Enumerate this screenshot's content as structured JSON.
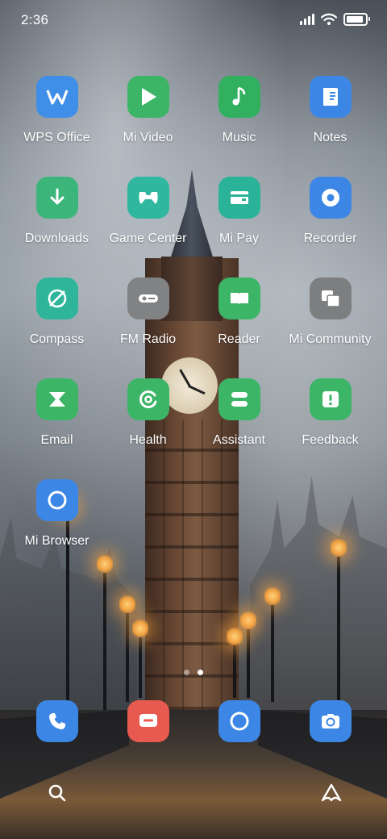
{
  "status_bar": {
    "time": "2:36",
    "icons": [
      "signal-icon",
      "wifi-icon",
      "battery-icon"
    ]
  },
  "apps": [
    {
      "label": "WPS Office",
      "icon": "wps-office-icon",
      "color": "#3f8ee8"
    },
    {
      "label": "Mi Video",
      "icon": "play-icon",
      "color": "#3cb567"
    },
    {
      "label": "Music",
      "icon": "music-note-icon",
      "color": "#31b060"
    },
    {
      "label": "Notes",
      "icon": "notes-icon",
      "color": "#3c87e6"
    },
    {
      "label": "Downloads",
      "icon": "download-arrow-icon",
      "color": "#3cb57a"
    },
    {
      "label": "Game Center",
      "icon": "gamepad-icon",
      "color": "#2fb7a0"
    },
    {
      "label": "Mi Pay",
      "icon": "wallet-icon",
      "color": "#2bb39a"
    },
    {
      "label": "Recorder",
      "icon": "record-icon",
      "color": "#3c87e6"
    },
    {
      "label": "Compass",
      "icon": "compass-icon",
      "color": "#2eb59a"
    },
    {
      "label": "FM Radio",
      "icon": "radio-icon",
      "color": "#808284"
    },
    {
      "label": "Reader",
      "icon": "book-icon",
      "color": "#3cb567"
    },
    {
      "label": "Mi Community",
      "icon": "community-icon",
      "color": "#7c7e80"
    },
    {
      "label": "Email",
      "icon": "email-icon",
      "color": "#3cb567"
    },
    {
      "label": "Health",
      "icon": "health-icon",
      "color": "#3cb567"
    },
    {
      "label": "Assistant",
      "icon": "assistant-icon",
      "color": "#3cb567"
    },
    {
      "label": "Feedback",
      "icon": "feedback-icon",
      "color": "#3cb567"
    },
    {
      "label": "Mi Browser",
      "icon": "browser-icon",
      "color": "#3c87e6"
    }
  ],
  "page_indicator": {
    "count": 2,
    "active_index": 1
  },
  "dock": [
    {
      "name": "phone",
      "icon": "phone-icon",
      "color": "#3c87e6"
    },
    {
      "name": "messages",
      "icon": "message-icon",
      "color": "#e85a4f"
    },
    {
      "name": "browser",
      "icon": "browser-icon",
      "color": "#3c87e6"
    },
    {
      "name": "camera",
      "icon": "camera-icon",
      "color": "#3c87e6"
    }
  ],
  "bottom_bar": {
    "left_icon": "search-icon",
    "right_icon": "app-vault-icon"
  }
}
